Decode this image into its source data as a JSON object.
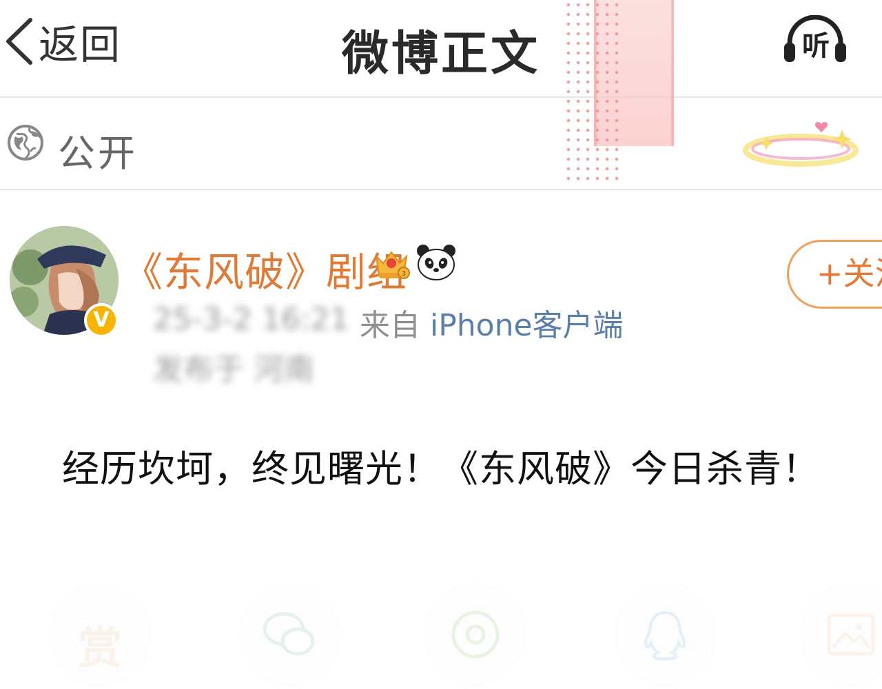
{
  "header": {
    "back_label": "返回",
    "title": "微博正文",
    "listen_label": "听"
  },
  "visibility": {
    "icon": "globe-icon",
    "label": "公开"
  },
  "post": {
    "author": "《东风破》剧组",
    "time": "25-3-2 16:21",
    "source_prefix": "来自",
    "source_device": "iPhone客户端",
    "location": "发布于 河南",
    "follow_label": "+关注",
    "text": "经历坎坷，终见曙光！《东风破》今日杀青！"
  },
  "actions": {
    "reward_label": "赏",
    "icons": [
      "reward-icon",
      "comment-icon",
      "lens-icon",
      "qq-icon",
      "image-icon"
    ]
  },
  "colors": {
    "author": "#e07a36",
    "follow_border": "#f0a05a",
    "device_link": "#5b7fa8",
    "verified": "#f7b500"
  }
}
